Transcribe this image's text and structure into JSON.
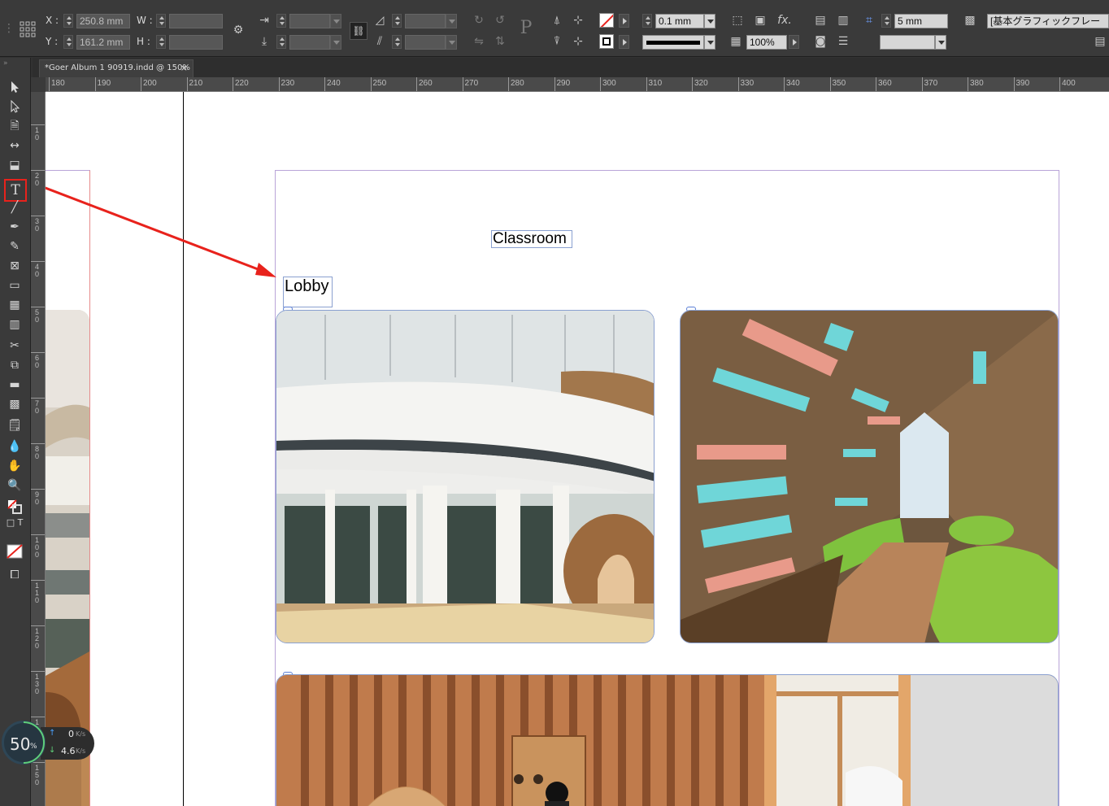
{
  "control_panel": {
    "x_label": "X :",
    "y_label": "Y :",
    "w_label": "W :",
    "h_label": "H :",
    "x_value": "250.8 mm",
    "y_value": "161.2 mm",
    "stroke_weight": "0.1 mm",
    "opacity": "100%",
    "gap_value": "5 mm",
    "object_style": "[基本グラフィックフレー"
  },
  "tab": {
    "title": "*Goer Album 1 90919.indd @ 150%",
    "close": "×"
  },
  "rulers": {
    "horizontal": [
      "180",
      "190",
      "200",
      "210",
      "220",
      "230",
      "240",
      "250",
      "260",
      "270",
      "280",
      "290",
      "300",
      "310",
      "320",
      "330",
      "340",
      "350",
      "360",
      "370",
      "380",
      "390",
      "400"
    ],
    "vertical": [
      "10",
      "20",
      "30",
      "40",
      "50",
      "60",
      "70",
      "80",
      "90",
      "100",
      "110",
      "120",
      "130",
      "140",
      "150"
    ]
  },
  "page": {
    "text_frames": {
      "classroom": "Classroom",
      "lobby": "Lobby"
    }
  },
  "network_widget": {
    "percent": "50",
    "percent_sign": "%",
    "upload": "0",
    "upload_unit": "K/s",
    "download": "4.6",
    "download_unit": "K/s"
  },
  "colors": {
    "annotation_red": "#e8221c",
    "selection_blue": "#5b7fd6",
    "margin_purple": "#b9a4d8"
  }
}
